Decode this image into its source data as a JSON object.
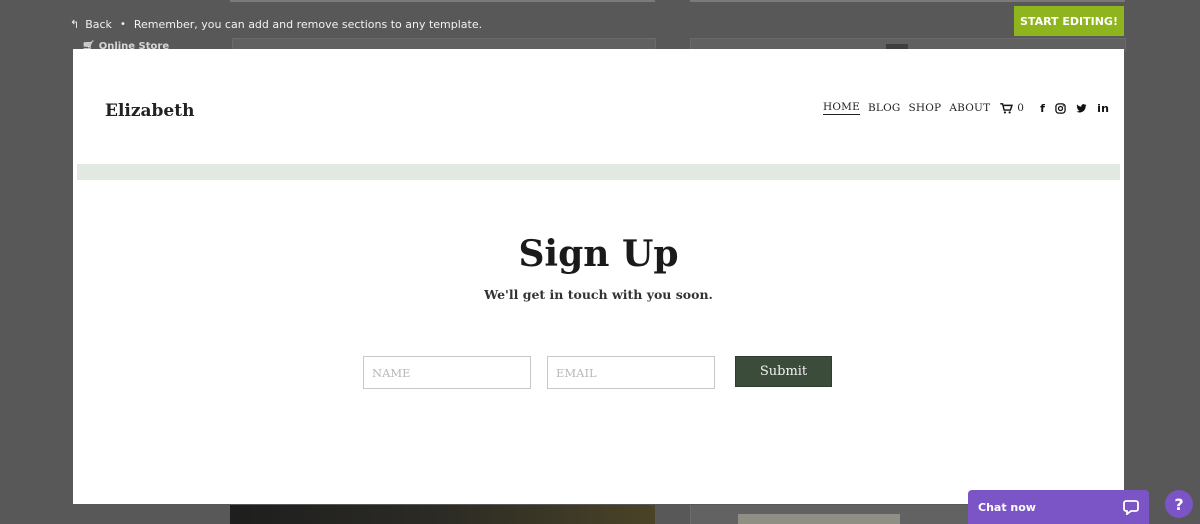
{
  "editor": {
    "back_label": "Back",
    "separator": "•",
    "hint": "Remember, you can add and remove sections to any template.",
    "start_editing": "START EDITING!",
    "online_store": "Online Store"
  },
  "site": {
    "name": "Elizabeth",
    "nav": [
      "HOME",
      "BLOG",
      "SHOP",
      "ABOUT"
    ],
    "cart_count": "0",
    "social_icons": [
      "facebook-icon",
      "instagram-icon",
      "twitter-icon",
      "linkedin-icon"
    ]
  },
  "signup": {
    "title": "Sign Up",
    "subtitle": "We'll get in touch with you soon.",
    "name_placeholder": "NAME",
    "email_placeholder": "EMAIL",
    "submit_label": "Submit"
  },
  "chat": {
    "label": "Chat now",
    "help": "?"
  },
  "colors": {
    "accent_green": "#8fb51e",
    "submit_bg": "#3b4c3b",
    "band": "#e2e8e2",
    "chat_purple": "#7b54c5"
  }
}
